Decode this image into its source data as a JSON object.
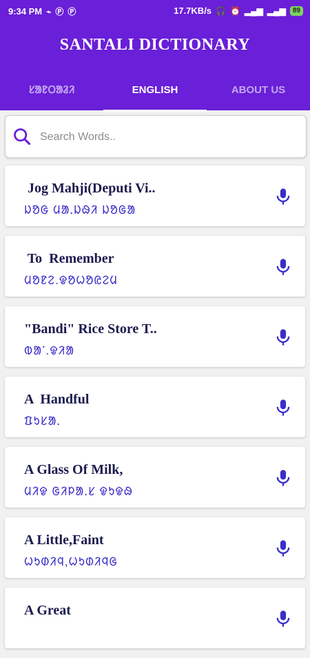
{
  "status_bar": {
    "time": "9:34 PM",
    "network_speed": "17.7KB/s",
    "battery": "89",
    "icons": [
      "usb-icon",
      "p-icon",
      "p-icon",
      "headset-icon",
      "alarm-icon",
      "signal-icon",
      "signal-icon",
      "battery-icon"
    ]
  },
  "app": {
    "title": "SANTALI DICTIONARY"
  },
  "tabs": [
    {
      "label": "ᱥᱟᱱᱛᱟᱲᱤ"
    },
    {
      "label": "ENGLISH"
    },
    {
      "label": "ABOUT US"
    }
  ],
  "search": {
    "placeholder": "Search Words.."
  },
  "entries": [
    {
      "english": " Jog Mahji(Deputi Vi..",
      "santali": "ᱡᱚᱜ ᱢᱟᱹᱡᱷᱤ ᱡᱚᱜᱟ"
    },
    {
      "english": " To  Remember",
      "santali": "ᱢᱚᱱᱮ.ᱫᱚᱦᱚᱭᱮᱢ"
    },
    {
      "english": "\"Bandi\" Rice Store T..",
      "santali": "ᱵᱟᱸ.ᱫᱤᱟ"
    },
    {
      "english": "A  Handful",
      "santali": "ᱯᱩᱥᱟᱹ"
    },
    {
      "english": "A Glass Of Milk,",
      "santali": "ᱢᱤᱫ ᱜᱤᱞᱟᱹᱥ ᱫᱩᱫᱷ"
    },
    {
      "english": "A Little,Faint",
      "santali": "ᱦᱩᱰᱤᱧ,ᱦᱩᱰᱤᱧᱜ"
    },
    {
      "english": "A Great",
      "santali": ""
    }
  ],
  "colors": {
    "primary": "#6a1fd8",
    "mic": "#3a2ec9",
    "search_icon": "#6a1fd8"
  }
}
